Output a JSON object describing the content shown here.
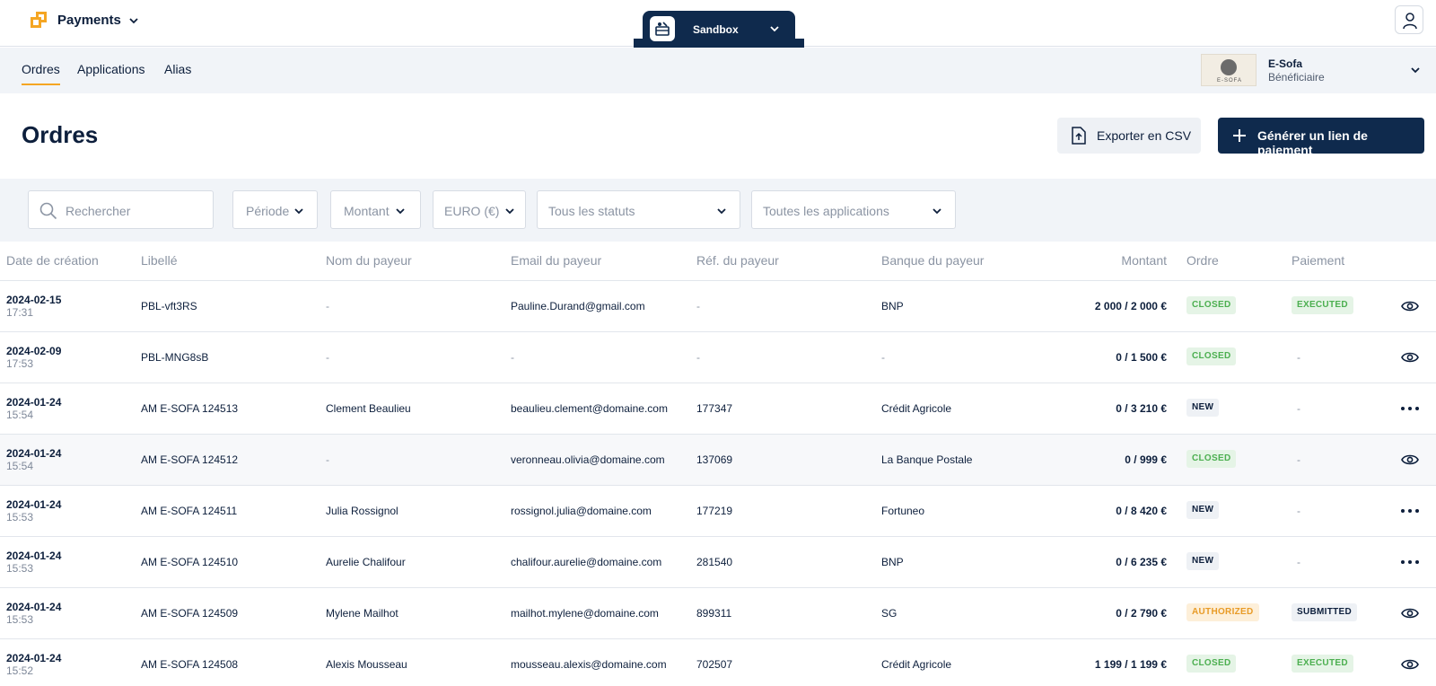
{
  "header": {
    "brand": "Payments",
    "environment": "Sandbox"
  },
  "nav": {
    "tabs": [
      "Ordres",
      "Applications",
      "Alias"
    ],
    "active": "Ordres"
  },
  "merchant": {
    "logo_text": "E-SOFA",
    "name": "E-Sofa",
    "role": "Bénéficiaire"
  },
  "page": {
    "title": "Ordres",
    "export_label": "Exporter en CSV",
    "generate_label": "Générer un lien de paiement"
  },
  "filters": {
    "search_placeholder": "Rechercher",
    "periode": "Période",
    "montant": "Montant",
    "currency": "EURO (€)",
    "statuts": "Tous les statuts",
    "applications": "Toutes les applications"
  },
  "table": {
    "columns": [
      "Date de création",
      "Libellé",
      "Nom du payeur",
      "Email du payeur",
      "Réf. du payeur",
      "Banque du payeur",
      "Montant",
      "Ordre",
      "Paiement"
    ],
    "rows": [
      {
        "date": "2024-02-15",
        "time": "17:31",
        "libelle": "PBL-vft3RS",
        "nom": "-",
        "email": "Pauline.Durand@gmail.com",
        "ref": "-",
        "banque": "BNP",
        "montant": "2 000 / 2 000 €",
        "ordre": "CLOSED",
        "paiement": "EXECUTED",
        "action": "eye"
      },
      {
        "date": "2024-02-09",
        "time": "17:53",
        "libelle": "PBL-MNG8sB",
        "nom": "-",
        "email": "-",
        "ref": "-",
        "banque": "-",
        "montant": "0 / 1 500 €",
        "ordre": "CLOSED",
        "paiement": "-",
        "action": "eye"
      },
      {
        "date": "2024-01-24",
        "time": "15:54",
        "libelle": "AM E-SOFA 124513",
        "nom": "Clement Beaulieu",
        "email": "beaulieu.clement@domaine.com",
        "ref": "177347",
        "banque": "Crédit Agricole",
        "montant": "0 / 3 210 €",
        "ordre": "NEW",
        "paiement": "-",
        "action": "more"
      },
      {
        "date": "2024-01-24",
        "time": "15:54",
        "libelle": "AM E-SOFA 124512",
        "nom": "-",
        "email": "veronneau.olivia@domaine.com",
        "ref": "137069",
        "banque": "La Banque Postale",
        "montant": "0 / 999 €",
        "ordre": "CLOSED",
        "paiement": "-",
        "action": "eye"
      },
      {
        "date": "2024-01-24",
        "time": "15:53",
        "libelle": "AM E-SOFA 124511",
        "nom": "Julia Rossignol",
        "email": "rossignol.julia@domaine.com",
        "ref": "177219",
        "banque": "Fortuneo",
        "montant": "0 / 8 420 €",
        "ordre": "NEW",
        "paiement": "-",
        "action": "more"
      },
      {
        "date": "2024-01-24",
        "time": "15:53",
        "libelle": "AM E-SOFA 124510",
        "nom": "Aurelie Chalifour",
        "email": "chalifour.aurelie@domaine.com",
        "ref": "281540",
        "banque": "BNP",
        "montant": "0 / 6 235 €",
        "ordre": "NEW",
        "paiement": "-",
        "action": "more"
      },
      {
        "date": "2024-01-24",
        "time": "15:53",
        "libelle": "AM E-SOFA 124509",
        "nom": "Mylene Mailhot",
        "email": "mailhot.mylene@domaine.com",
        "ref": "899311",
        "banque": "SG",
        "montant": "0 / 2 790 €",
        "ordre": "AUTHORIZED",
        "paiement": "SUBMITTED",
        "action": "eye"
      },
      {
        "date": "2024-01-24",
        "time": "15:52",
        "libelle": "AM E-SOFA 124508",
        "nom": "Alexis Mousseau",
        "email": "mousseau.alexis@domaine.com",
        "ref": "702507",
        "banque": "Crédit Agricole",
        "montant": "1 199 / 1 199 €",
        "ordre": "CLOSED",
        "paiement": "EXECUTED",
        "action": "eye"
      }
    ]
  },
  "colors": {
    "navy": "#0f2a4d",
    "accent": "#f5a623",
    "success": "#4caf50",
    "warning": "#e89b27"
  }
}
